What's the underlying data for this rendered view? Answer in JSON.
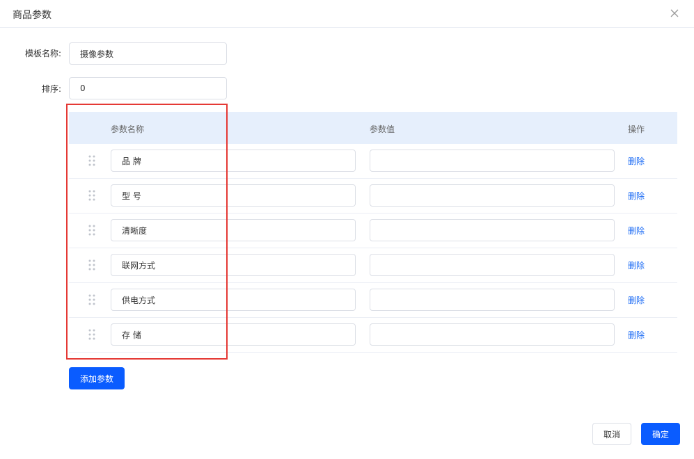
{
  "dialog": {
    "title": "商品参数"
  },
  "form": {
    "template_name_label": "模板名称:",
    "template_name_value": "摄像参数",
    "sort_label": "排序:",
    "sort_value": "0"
  },
  "table": {
    "headers": {
      "name": "参数名称",
      "value": "参数值",
      "action": "操作"
    },
    "rows": [
      {
        "name": "品 牌",
        "value": "",
        "action": "删除"
      },
      {
        "name": "型 号",
        "value": "",
        "action": "删除"
      },
      {
        "name": "清晰度",
        "value": "",
        "action": "删除"
      },
      {
        "name": "联网方式",
        "value": "",
        "action": "删除"
      },
      {
        "name": "供电方式",
        "value": "",
        "action": "删除"
      },
      {
        "name": "存 储",
        "value": "",
        "action": "删除"
      }
    ]
  },
  "buttons": {
    "add_param": "添加参数",
    "cancel": "取消",
    "confirm": "确定"
  },
  "icons": {
    "close": "close-icon",
    "drag": "drag-handle-icon"
  },
  "colors": {
    "primary": "#0a5cff",
    "link": "#1d6cf5",
    "table_header_bg": "#e6effc",
    "highlight": "#e53935"
  }
}
